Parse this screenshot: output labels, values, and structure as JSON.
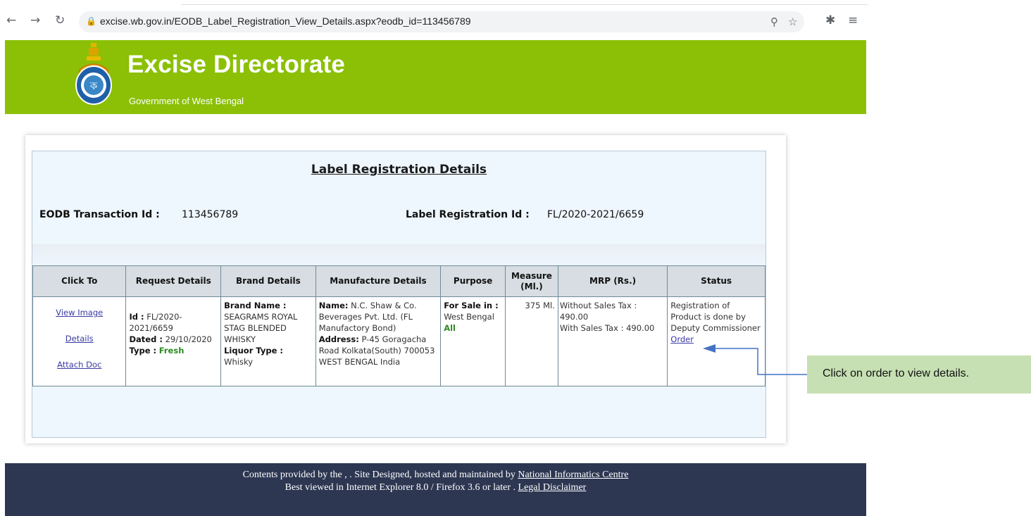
{
  "browser": {
    "url": "excise.wb.gov.in/EODB_Label_Registration_View_Details.aspx?eodb_id=113456789"
  },
  "header": {
    "title": "Excise Directorate",
    "subtitle": "Government of West Bengal"
  },
  "details": {
    "heading": "Label Registration Details",
    "eodb_label": "EODB Transaction Id :",
    "eodb_value": "113456789",
    "label_reg_label": "Label Registration Id :",
    "label_reg_value": "FL/2020-2021/6659"
  },
  "table": {
    "headers": [
      "Click To",
      "Request Details",
      "Brand Details",
      "Manufacture Details",
      "Purpose",
      "Measure (Ml.)",
      "MRP (Rs.)",
      "Status"
    ],
    "row": {
      "links": [
        "View Image",
        "Details",
        "Attach Doc"
      ],
      "request": {
        "id_label": "Id :",
        "id_value": "FL/2020-2021/6659",
        "dated_label": "Dated :",
        "dated_value": "29/10/2020",
        "type_label": "Type :",
        "type_value": "Fresh"
      },
      "brand": {
        "name_label": "Brand Name :",
        "name_value": "SEAGRAMS ROYAL STAG BLENDED WHISKY",
        "liquor_label": "Liquor Type :",
        "liquor_value": "Whisky"
      },
      "manufacture": {
        "name_label": "Name:",
        "name_value": "N.C. Shaw & Co. Beverages Pvt. Ltd. (FL Manufactory Bond)",
        "address_label": "Address:",
        "address_value": "P-45 Goragacha Road Kolkata(South) 700053 WEST BENGAL India"
      },
      "purpose": {
        "label": "For Sale in :",
        "state": "West Bengal",
        "scope": "All"
      },
      "measure": "375 Ml.",
      "mrp": {
        "without": "Without Sales Tax : 490.00",
        "with": "With Sales Tax : 490.00"
      },
      "status": {
        "text": "Registration of Product is done by Deputy Commissioner",
        "order_link": "Order"
      }
    }
  },
  "annotation": {
    "callout": "Click on order to view details."
  },
  "footer": {
    "line1_text": "Contents provided by the , . Site Designed, hosted and maintained by",
    "line1_link": "National Informatics Centre",
    "line2_text": "Best viewed in Internet Explorer 8.0 / Firefox 3.6 or later .",
    "line2_link": "Legal Disclaimer"
  }
}
